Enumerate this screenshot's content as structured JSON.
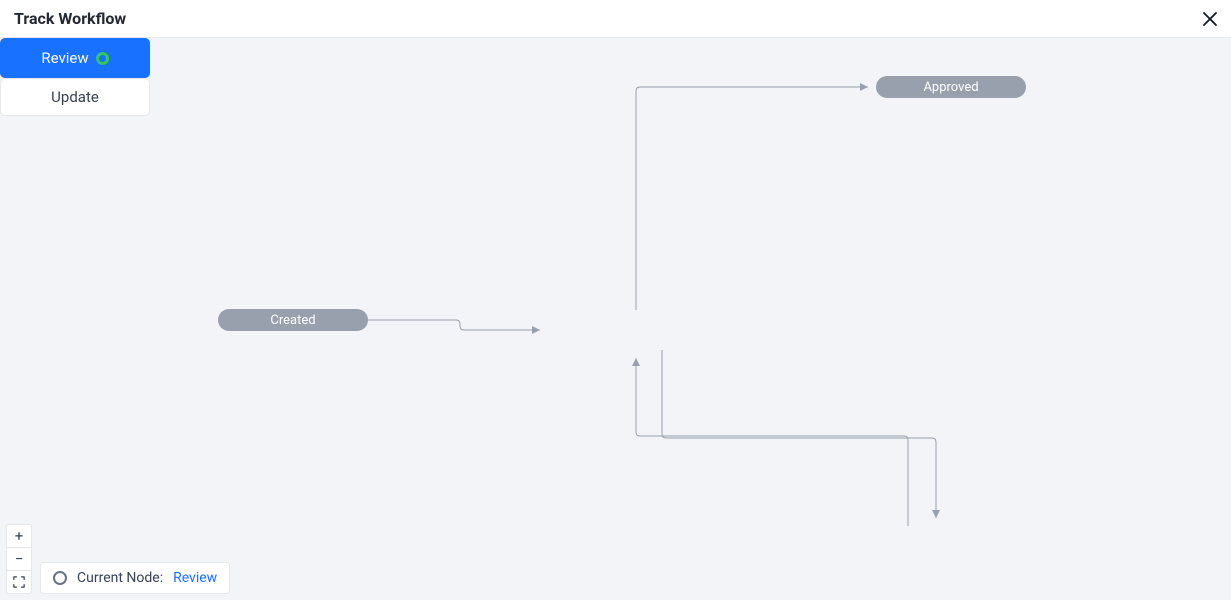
{
  "header": {
    "title": "Track Workflow"
  },
  "nodes": {
    "created": {
      "label": "Created"
    },
    "approved": {
      "label": "Approved"
    },
    "review": {
      "label": "Review"
    },
    "update": {
      "label": "Update"
    }
  },
  "status": {
    "label": "Current Node:",
    "value": "Review"
  },
  "zoom": {
    "in": "+",
    "out": "−"
  }
}
